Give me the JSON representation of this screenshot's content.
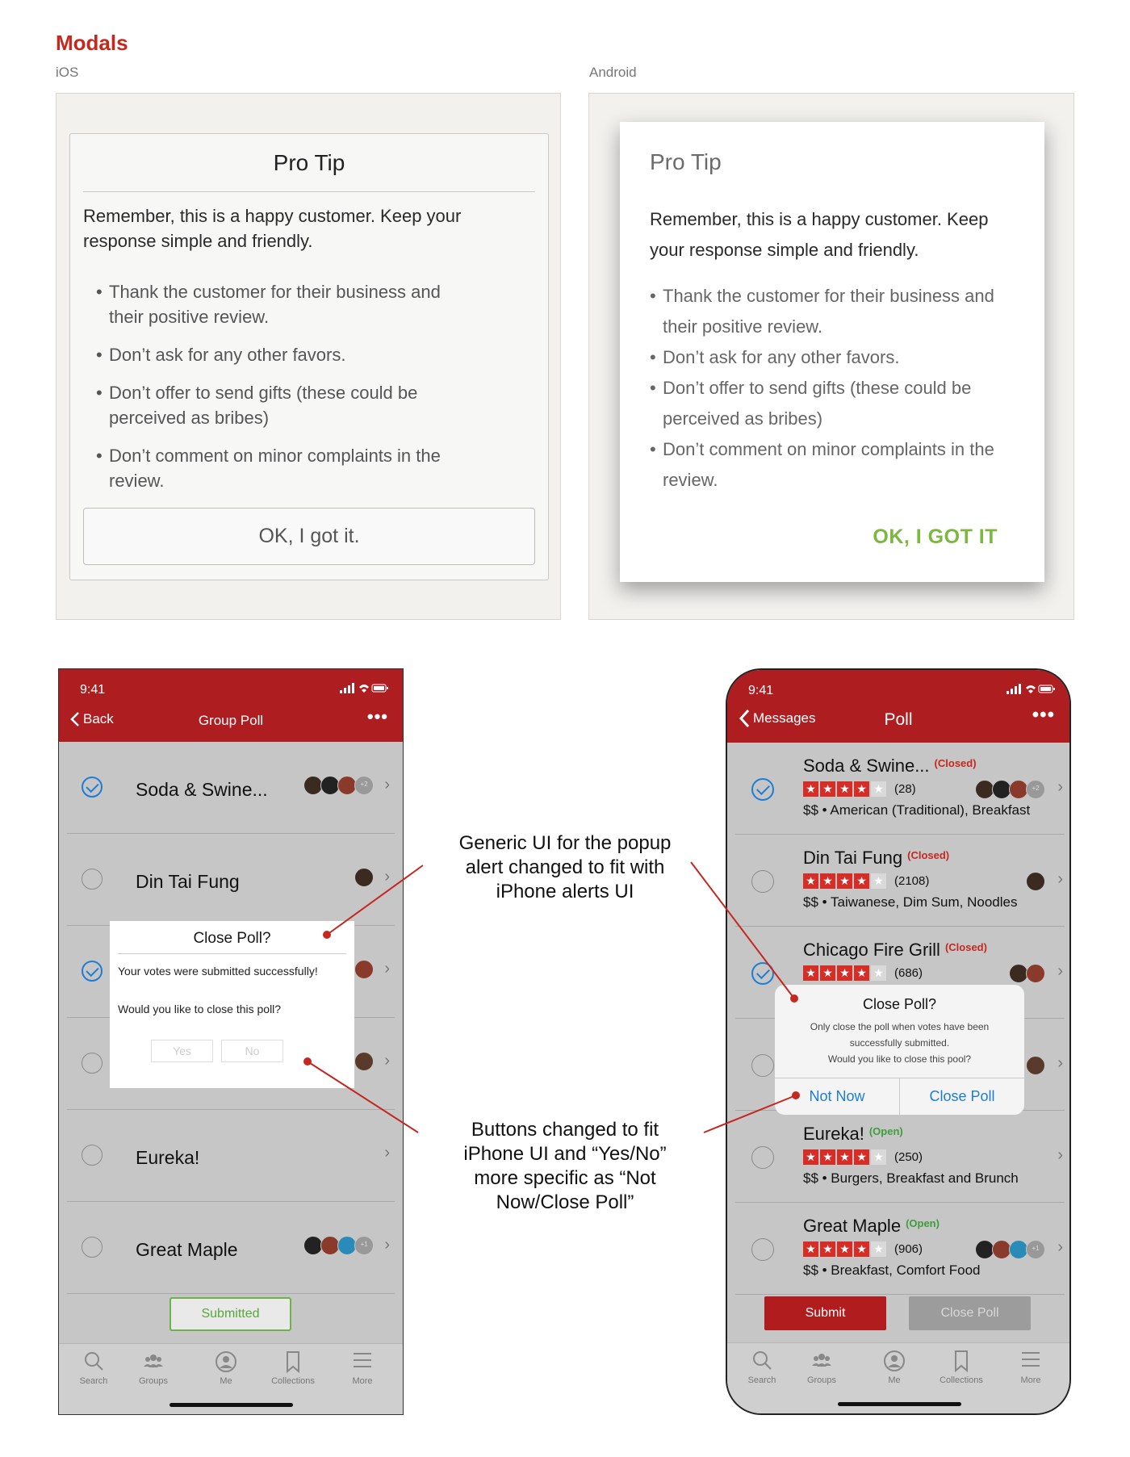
{
  "page": {
    "title": "Modals",
    "ios_label": "iOS",
    "android_label": "Android"
  },
  "ios_modal": {
    "title": "Pro Tip",
    "body": "Remember, this is a happy customer. Keep your response simple and friendly.",
    "bullets": [
      "Thank the customer for their business and their positive review.",
      "Don’t ask for any other favors.",
      "Don’t offer to send gifts (these could be perceived as bribes)",
      "Don’t comment on minor complaints in the review."
    ],
    "button": "OK, I got it."
  },
  "android_modal": {
    "title": "Pro Tip",
    "body": "Remember, this is a happy customer. Keep your response simple and friendly.",
    "bullets": [
      "Thank the customer for their business and their positive review.",
      "Don’t ask for any other favors.",
      "Don’t offer to send gifts (these could be perceived as bribes)",
      "Don’t comment on minor complaints in the review."
    ],
    "button": "OK, I GOT IT",
    "button_color": "#7cb83f"
  },
  "left_phone": {
    "time": "9:41",
    "back": "Back",
    "title": "Group Poll",
    "rows": [
      {
        "name": "Soda & Swine...",
        "checked": true
      },
      {
        "name": "Din Tai Fung",
        "checked": false
      },
      {
        "name": "",
        "checked": true
      },
      {
        "name": "",
        "checked": false
      },
      {
        "name": "Eureka!",
        "checked": false
      },
      {
        "name": "Great Maple",
        "checked": false
      }
    ],
    "modal": {
      "title": "Close Poll?",
      "text": "Your votes were submitted successfully!",
      "question": "Would you like to close this poll?",
      "yes": "Yes",
      "no": "No"
    },
    "submitted_button": "Submitted",
    "avatar_badges": [
      "+2",
      "+1"
    ]
  },
  "right_phone": {
    "time": "9:41",
    "back": "Messages",
    "title": "Poll",
    "rows": [
      {
        "name": "Soda & Swine...",
        "status": "(Closed)",
        "count": "(28)",
        "category": "$$ • American (Traditional), Breakfast",
        "checked": true
      },
      {
        "name": "Din Tai Fung",
        "status": "(Closed)",
        "count": "(2108)",
        "category": "$$ • Taiwanese, Dim Sum, Noodles",
        "checked": false
      },
      {
        "name": "Chicago Fire Grill",
        "status": "(Closed)",
        "count": "(686)",
        "category": "",
        "checked": true
      },
      {
        "name": "",
        "status": "",
        "count": "",
        "category": "",
        "checked": false
      },
      {
        "name": "Eureka!",
        "status": "(Open)",
        "count": "(250)",
        "category": "$$ • Burgers, Breakfast and Brunch",
        "checked": false
      },
      {
        "name": "Great Maple",
        "status": "(Open)",
        "count": "(906)",
        "category": "$$ • Breakfast, Comfort Food",
        "checked": false
      }
    ],
    "modal": {
      "title": "Close Poll?",
      "text_1": "Only close the poll when votes have been",
      "text_2": "successfully submitted.",
      "text_3": "Would you like to close this pool?",
      "not_now": "Not Now",
      "close_poll": "Close Poll"
    },
    "submit_button": "Submit",
    "close_poll_button": "Close Poll",
    "avatar_badges": [
      "+2",
      "+1"
    ]
  },
  "tabs": [
    "Search",
    "Groups",
    "Me",
    "Collections",
    "More"
  ],
  "annotations": {
    "top": "Generic UI for the popup alert changed to fit with iPhone alerts UI",
    "bottom": "Buttons changed to fit iPhone UI and “Yes/No” more specific as “Not Now/Close Poll”"
  },
  "colors": {
    "brand_red": "#ae1e20",
    "title_red": "#c4281f",
    "ios_blue": "#1d7dd4",
    "annotation_line": "#c4281f"
  },
  "icons": [
    "chevron-left-icon",
    "more-dots-icon",
    "checkmark-icon",
    "chevron-right-icon",
    "star-icon",
    "search-icon",
    "groups-icon",
    "me-icon",
    "collections-icon",
    "more-icon",
    "signal-icon",
    "wifi-icon",
    "battery-icon"
  ]
}
